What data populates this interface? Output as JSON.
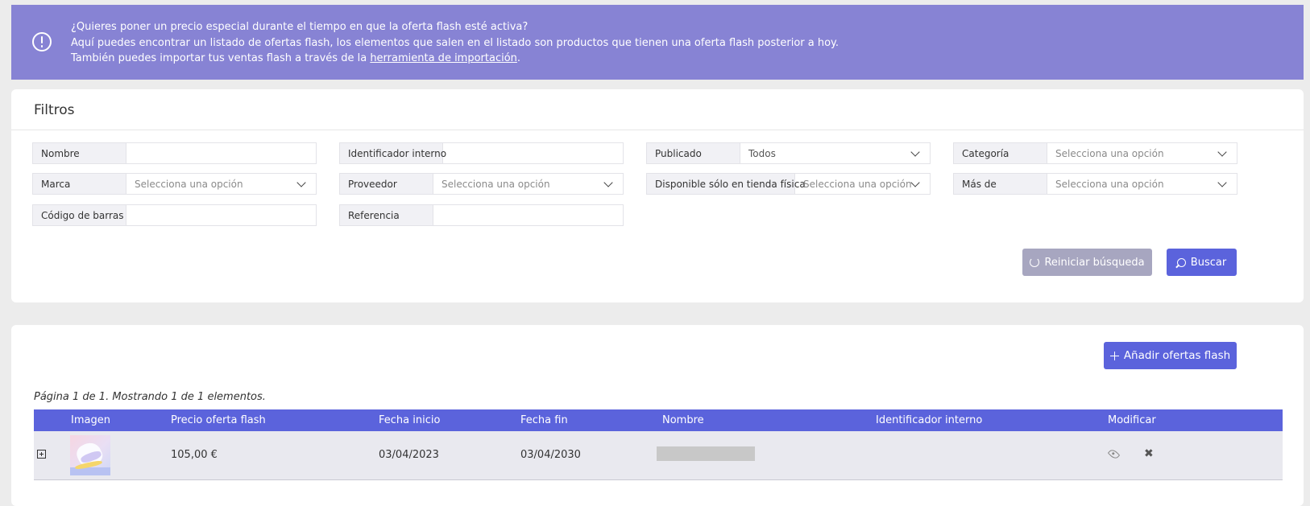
{
  "alert": {
    "line1": "¿Quieres poner un precio especial durante el tiempo en que la oferta flash esté activa?",
    "line2": "Aquí puedes encontrar un listado de ofertas flash, los elementos que salen en el listado son productos que tienen una oferta flash posterior a hoy.",
    "line3_prefix": "También puedes importar tus ventas flash a través de la ",
    "line3_link": "herramienta de importación",
    "line3_suffix": "."
  },
  "filters": {
    "title": "Filtros",
    "nombre": {
      "label": "Nombre",
      "value": ""
    },
    "identificador": {
      "label": "Identificador interno",
      "value": ""
    },
    "publicado": {
      "label": "Publicado",
      "value": "Todos"
    },
    "categoria": {
      "label": "Categoría",
      "placeholder": "Selecciona una opción"
    },
    "marca": {
      "label": "Marca",
      "placeholder": "Selecciona una opción"
    },
    "proveedor": {
      "label": "Proveedor",
      "placeholder": "Selecciona una opción"
    },
    "disponible": {
      "label": "Disponible sólo en tienda física",
      "placeholder": "Selecciona una opción"
    },
    "mas_de": {
      "label": "Más de",
      "placeholder": "Selecciona una opción"
    },
    "codigo": {
      "label": "Código de barras",
      "value": ""
    },
    "referencia": {
      "label": "Referencia",
      "value": ""
    },
    "reset_label": "Reiniciar búsqueda",
    "search_label": "Buscar"
  },
  "list": {
    "add_label": "Añadir ofertas flash",
    "pagination": "Página 1 de 1. Mostrando 1 de 1 elementos.",
    "columns": [
      "Imagen",
      "Precio oferta flash",
      "Fecha inicio",
      "Fecha fin",
      "Nombre",
      "Identificador interno",
      "Modificar"
    ],
    "rows": [
      {
        "precio": "105,00 €",
        "inicio": "03/04/2023",
        "fin": "03/04/2030",
        "nombre": "",
        "identificador": ""
      }
    ]
  },
  "colors": {
    "accent": "#5b63dc",
    "alert_bg": "#8783d4",
    "reset_bg": "#a7a6c0"
  }
}
